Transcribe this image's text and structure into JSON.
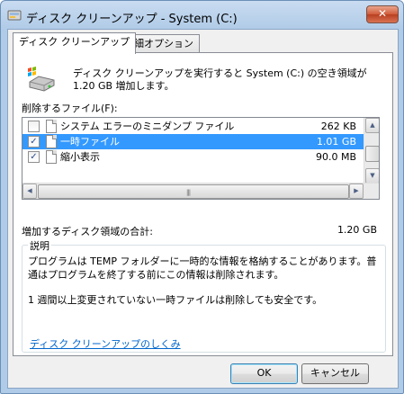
{
  "window": {
    "title": "ディスク クリーンアップ - System (C:)",
    "close_glyph": "✕"
  },
  "tabs": [
    {
      "label": "ディスク クリーンアップ",
      "active": true
    },
    {
      "label": "詳細オプション",
      "active": false
    }
  ],
  "intro": {
    "text": "ディスク クリーンアップを実行すると System (C:) の空き領域が 1.20 GB 増加します。",
    "icon": "disk-cleanup-icon"
  },
  "files_label": "削除するファイル(F):",
  "files": [
    {
      "name": "システム エラーのミニダンプ ファイル",
      "size": "262 KB",
      "checked": false,
      "selected": false
    },
    {
      "name": "一時ファイル",
      "size": "1.01 GB",
      "checked": true,
      "selected": true
    },
    {
      "name": "縮小表示",
      "size": "90.0 MB",
      "checked": true,
      "selected": false
    }
  ],
  "total": {
    "label": "増加するディスク領域の合計:",
    "value": "1.20 GB"
  },
  "description": {
    "legend": "説明",
    "paragraph1": "プログラムは TEMP フォルダーに一時的な情報を格納することがあります。普通はプログラムを終了する前にこの情報は削除されます。",
    "paragraph2": "1 週間以上変更されていない一時ファイルは削除しても安全です。"
  },
  "link": "ディスク クリーンアップのしくみ",
  "buttons": {
    "ok": "OK",
    "cancel": "キャンセル"
  },
  "scrollbar_glyphs": {
    "up": "▲",
    "down": "▼",
    "left": "◀",
    "right": "▶",
    "grip": "|||"
  },
  "checkmark": "✓",
  "colors": {
    "selection": "#3399ff",
    "link": "#0066cc",
    "title_bar": "#b9d1ea"
  }
}
